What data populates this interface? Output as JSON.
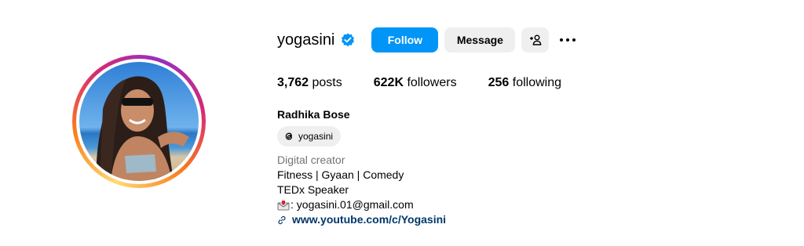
{
  "profile": {
    "username": "yogasini",
    "verified": true,
    "follow_label": "Follow",
    "message_label": "Message",
    "posts_count": "3,762",
    "posts_label": "posts",
    "followers_count": "622K",
    "followers_label": "followers",
    "following_count": "256",
    "following_label": "following",
    "full_name": "Radhika Bose",
    "threads_handle": "yogasini",
    "category": "Digital creator",
    "bio_lines": [
      "Fitness | Gyaan | Comedy",
      "TEDx Speaker"
    ],
    "email_line": ": yogasini.01@gmail.com",
    "link": "www.youtube.com/c/Yogasini"
  },
  "colors": {
    "follow_button": "#0095f6",
    "secondary_button": "#efefef",
    "link": "#00376b",
    "category": "#737373",
    "verified_badge": "#0095f6"
  },
  "icons": [
    "verified-badge-icon",
    "add-user-icon",
    "more-options-icon",
    "threads-icon",
    "envelope-icon",
    "link-icon"
  ]
}
